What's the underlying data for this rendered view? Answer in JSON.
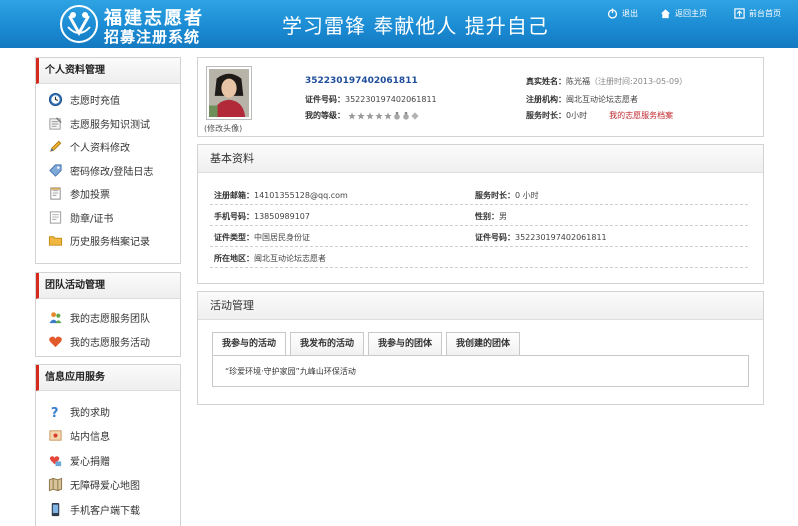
{
  "header": {
    "brand_line1": "福建志愿者",
    "brand_line2": "招募注册系统",
    "slogan": "学习雷锋 奉献他人 提升自己",
    "links": [
      {
        "label": "退出",
        "icon": "power-icon"
      },
      {
        "label": "返回主页",
        "icon": "home-icon"
      },
      {
        "label": "前台首页",
        "icon": "frontpage-icon"
      }
    ]
  },
  "sidebar": {
    "personal": {
      "title": "个人资料管理",
      "items": [
        "志愿时充值",
        "志愿服务知识测试",
        "个人资料修改",
        "密码修改/登陆日志",
        "参加投票",
        "勋章/证书",
        "历史服务档案记录"
      ]
    },
    "team": {
      "title": "团队活动管理",
      "items": [
        "我的志愿服务团队",
        "我的志愿服务活动"
      ]
    },
    "info": {
      "title": "信息应用服务",
      "items": [
        "我的求助",
        "站内信息",
        "爱心捐赠",
        "无障碍爱心地图",
        "手机客户端下载"
      ]
    }
  },
  "profile": {
    "avatar_caption": "(修改头像)",
    "volunteer_id": "352230197402061811",
    "cert_label": "证件号码：",
    "cert_value": "352230197402061811",
    "level_label": "我的等级：",
    "realname_label": "真实姓名：",
    "realname_value": "陈光福",
    "register_time": "（注册时间:2013-05-09）",
    "org_label": "注册机构：",
    "org_value": "闽北互动论坛志愿者",
    "hours_label": "服务时长：",
    "hours_value": "0小时",
    "archive_link": "我的志愿服务档案"
  },
  "basic": {
    "title": "基本资料",
    "email_label": "注册邮箱：",
    "email_value": "14101355128@qq.com",
    "hours_label": "服务时长：",
    "hours_value": "0 小时",
    "phone_label": "手机号码：",
    "phone_value": "13850989107",
    "gender_label": "性别：",
    "gender_value": "男",
    "certtype_label": "证件类型：",
    "certtype_value": "中国居民身份证",
    "certno_label": "证件号码：",
    "certno_value": "352230197402061811",
    "region_label": "所在地区：",
    "region_value": "闽北互动论坛志愿者"
  },
  "activity": {
    "title": "活动管理",
    "tabs": [
      "我参与的活动",
      "我发布的活动",
      "我参与的团体",
      "我创建的团体"
    ],
    "items": [
      "“珍爱环境·守护家园”九峰山环保活动"
    ]
  },
  "colors": {
    "header_blue": "#1a8ad2",
    "accent_red": "#d72a1f",
    "link_blue": "#1f4e9b",
    "archive_red": "#c0282d"
  }
}
